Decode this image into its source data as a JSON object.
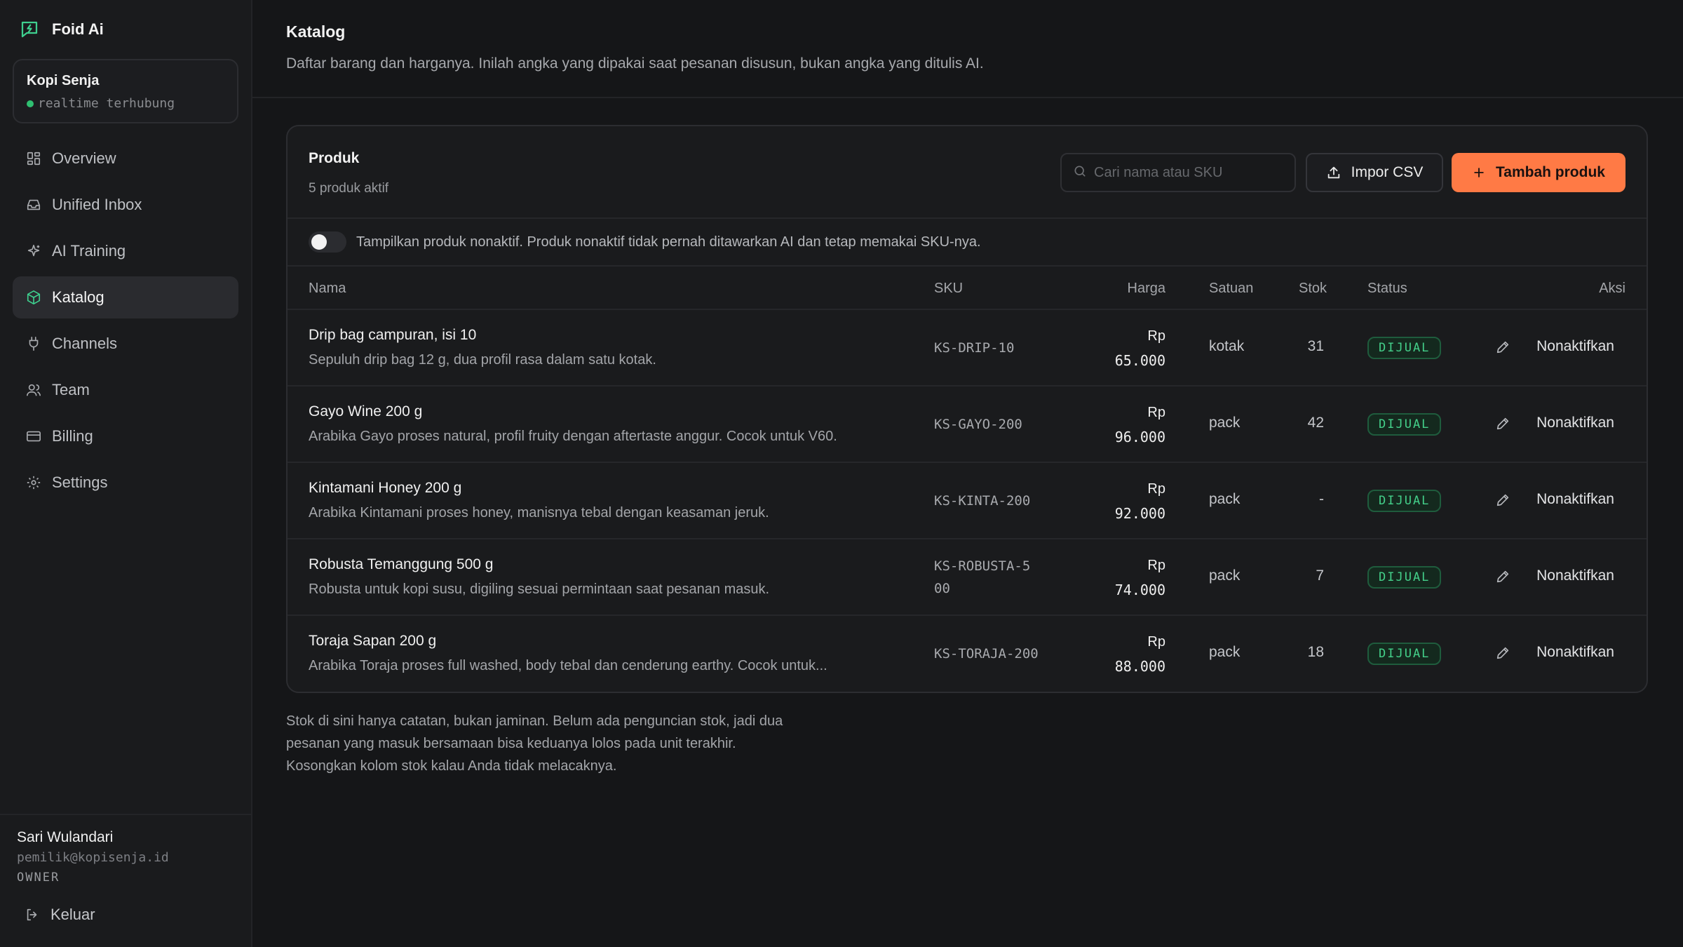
{
  "app": {
    "name": "Foid Ai"
  },
  "workspace": {
    "name": "Kopi Senja",
    "status": "realtime terhubung"
  },
  "nav": [
    {
      "label": "Overview",
      "icon": "grid-icon"
    },
    {
      "label": "Unified Inbox",
      "icon": "inbox-icon"
    },
    {
      "label": "AI Training",
      "icon": "sparkles-icon"
    },
    {
      "label": "Katalog",
      "icon": "box-icon",
      "active": true
    },
    {
      "label": "Channels",
      "icon": "plug-icon"
    },
    {
      "label": "Team",
      "icon": "users-icon"
    },
    {
      "label": "Billing",
      "icon": "credit-card-icon"
    },
    {
      "label": "Settings",
      "icon": "gear-icon"
    }
  ],
  "user": {
    "name": "Sari Wulandari",
    "email": "pemilik@kopisenja.id",
    "role": "OWNER",
    "logout_label": "Keluar"
  },
  "page": {
    "title": "Katalog",
    "subtitle": "Daftar barang dan harganya. Inilah angka yang dipakai saat pesanan disusun, bukan angka yang ditulis AI."
  },
  "products": {
    "title": "Produk",
    "count_text": "5 produk aktif",
    "search_placeholder": "Cari nama atau SKU",
    "import_label": "Impor CSV",
    "add_label": "Tambah produk",
    "toggle_text": "Tampilkan produk nonaktif. Produk nonaktif tidak pernah ditawarkan AI dan tetap memakai SKU-nya.",
    "toggle_on": false,
    "columns": {
      "name": "Nama",
      "sku": "SKU",
      "price": "Harga",
      "unit": "Satuan",
      "stock": "Stok",
      "status": "Status",
      "action": "Aksi"
    },
    "rows": [
      {
        "name": "Drip bag campuran, isi 10",
        "desc": "Sepuluh drip bag 12 g, dua profil rasa dalam satu kotak.",
        "sku": "KS-DRIP-10",
        "currency": "Rp",
        "price": "65.000",
        "unit": "kotak",
        "stock": "31",
        "status": "DIJUAL",
        "action": "Nonaktifkan"
      },
      {
        "name": "Gayo Wine 200 g",
        "desc": "Arabika Gayo proses natural, profil fruity dengan aftertaste anggur. Cocok untuk V60.",
        "sku": "KS-GAYO-200",
        "currency": "Rp",
        "price": "96.000",
        "unit": "pack",
        "stock": "42",
        "status": "DIJUAL",
        "action": "Nonaktifkan"
      },
      {
        "name": "Kintamani Honey 200 g",
        "desc": "Arabika Kintamani proses honey, manisnya tebal dengan keasaman jeruk.",
        "sku": "KS-KINTA-200",
        "currency": "Rp",
        "price": "92.000",
        "unit": "pack",
        "stock": "-",
        "status": "DIJUAL",
        "action": "Nonaktifkan"
      },
      {
        "name": "Robusta Temanggung 500 g",
        "desc": "Robusta untuk kopi susu, digiling sesuai permintaan saat pesanan masuk.",
        "sku": "KS-ROBUSTA-500",
        "currency": "Rp",
        "price": "74.000",
        "unit": "pack",
        "stock": "7",
        "status": "DIJUAL",
        "action": "Nonaktifkan"
      },
      {
        "name": "Toraja Sapan 200 g",
        "desc": "Arabika Toraja proses full washed, body tebal dan cenderung earthy. Cocok untuk...",
        "sku": "KS-TORAJA-200",
        "currency": "Rp",
        "price": "88.000",
        "unit": "pack",
        "stock": "18",
        "status": "DIJUAL",
        "action": "Nonaktifkan"
      }
    ]
  },
  "footnote": [
    "Stok di sini hanya catatan, bukan jaminan. Belum ada penguncian stok, jadi dua",
    "pesanan yang masuk bersamaan bisa keduanya lolos pada unit terakhir.",
    "Kosongkan kolom stok kalau Anda tidak melacaknya."
  ],
  "colors": {
    "accent": "#ff7a45",
    "status_green": "#44d08a",
    "online_dot": "#2fbf71"
  }
}
